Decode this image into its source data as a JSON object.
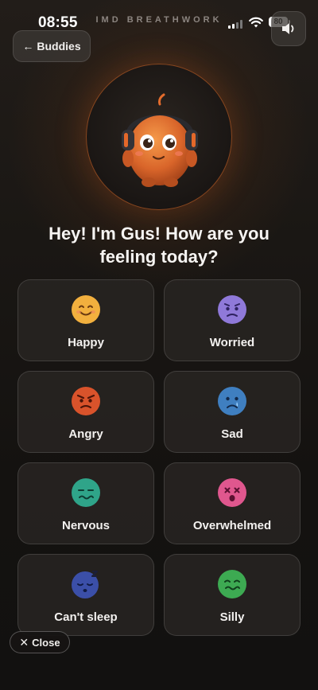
{
  "status_bar": {
    "time": "08:55",
    "battery": "80",
    "icons": [
      "signal-icon",
      "wifi-icon",
      "battery-icon"
    ]
  },
  "app": {
    "brand": "IMD BREATHWORK"
  },
  "header": {
    "buddies_label": "Buddies",
    "buddies_icon": "arrow-left-icon",
    "sound_icon": "speaker-icon"
  },
  "buddy": {
    "greeting": "Hey! I'm Gus! How are you feeling today?",
    "icon": "buddy-avatar"
  },
  "moods": [
    {
      "label": "Happy",
      "icon": "happy-face-icon",
      "color": "#F2B03E"
    },
    {
      "label": "Worried",
      "icon": "worried-face-icon",
      "color": "#8F79D9"
    },
    {
      "label": "Angry",
      "icon": "angry-face-icon",
      "color": "#D9532B"
    },
    {
      "label": "Sad",
      "icon": "sad-face-icon",
      "color": "#3F7FC0"
    },
    {
      "label": "Nervous",
      "icon": "nervous-face-icon",
      "color": "#2FA489"
    },
    {
      "label": "Overwhelmed",
      "icon": "overwhelmed-face-icon",
      "color": "#E0578E"
    },
    {
      "label": "Can't sleep",
      "icon": "sleepy-face-icon",
      "color": "#3B4FA8"
    },
    {
      "label": "Silly",
      "icon": "silly-face-icon",
      "color": "#3DAA52"
    }
  ],
  "footer": {
    "close_label": "Close",
    "close_icon": "close-icon"
  }
}
